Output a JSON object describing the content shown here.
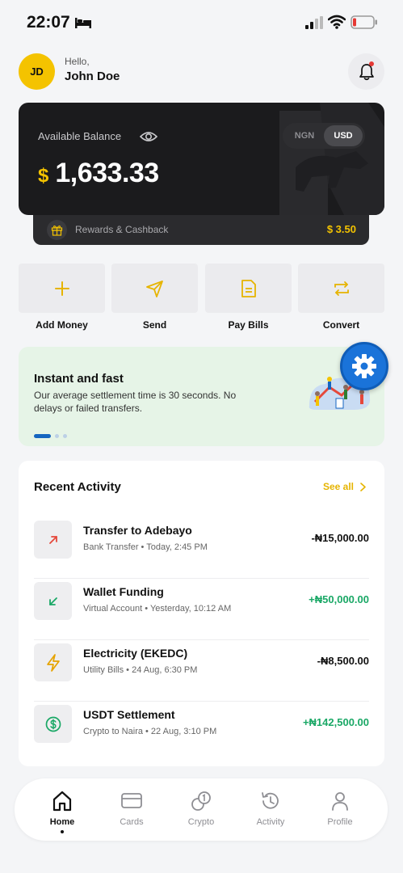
{
  "status_bar": {
    "time": "22:07"
  },
  "header": {
    "avatar_initials": "JD",
    "greeting": "Hello,",
    "username": "John Doe"
  },
  "balance": {
    "label": "Available Balance",
    "currency_options": [
      "NGN",
      "USD"
    ],
    "selected_currency": "USD",
    "symbol": "$",
    "amount": "1,633.33"
  },
  "rewards": {
    "label": "Rewards & Cashback",
    "amount": "$ 3.50"
  },
  "actions": [
    {
      "label": "Add Money",
      "icon": "plus-icon"
    },
    {
      "label": "Send",
      "icon": "send-icon"
    },
    {
      "label": "Pay Bills",
      "icon": "bill-icon"
    },
    {
      "label": "Convert",
      "icon": "convert-icon"
    }
  ],
  "promo": {
    "title": "Instant and fast",
    "text": "Our average settlement time is 30 seconds. No delays or failed transfers.",
    "slides": 3,
    "active_slide": 1
  },
  "activity": {
    "title": "Recent Activity",
    "see_all": "See all",
    "items": [
      {
        "title": "Transfer to Adebayo",
        "subtitle": "Bank Transfer • Today, 2:45 PM",
        "amount": "-₦15,000.00",
        "type": "debit",
        "icon": "arrow-up-right-icon",
        "color": "#e5483b"
      },
      {
        "title": "Wallet Funding",
        "subtitle": "Virtual Account • Yesterday, 10:12 AM",
        "amount": "+₦50,000.00",
        "type": "credit",
        "icon": "arrow-down-left-icon",
        "color": "#1aa866"
      },
      {
        "title": "Electricity (EKEDC)",
        "subtitle": "Utility Bills • 24 Aug, 6:30 PM",
        "amount": "-₦8,500.00",
        "type": "debit",
        "icon": "lightning-icon",
        "color": "#e6a300"
      },
      {
        "title": "USDT Settlement",
        "subtitle": "Crypto to Naira • 22 Aug, 3:10 PM",
        "amount": "+₦142,500.00",
        "type": "credit",
        "icon": "dollar-coin-icon",
        "color": "#1aa866"
      }
    ]
  },
  "nav": {
    "items": [
      "Home",
      "Cards",
      "Crypto",
      "Activity",
      "Profile"
    ],
    "active": "Home"
  },
  "colors": {
    "accent": "#f4c300",
    "credit": "#1aa866",
    "debit": "#111111",
    "card": "#1b1b1d",
    "settings_button": "#1a73d9"
  }
}
